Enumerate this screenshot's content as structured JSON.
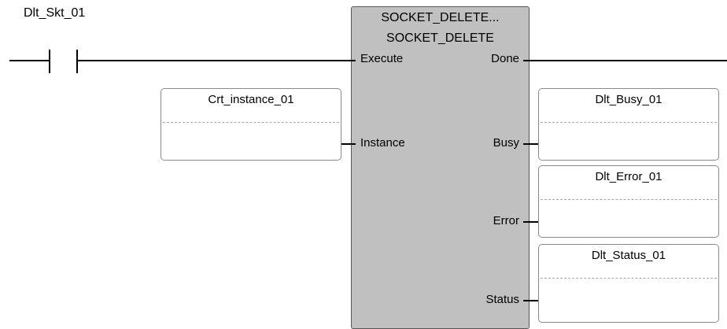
{
  "contact": {
    "variable": "Dlt_Skt_01"
  },
  "function_block": {
    "instance_name": "SOCKET_DELETE...",
    "type_name": "SOCKET_DELETE",
    "inputs": {
      "execute": "Execute",
      "instance": "Instance"
    },
    "outputs": {
      "done": "Done",
      "busy": "Busy",
      "error": "Error",
      "status": "Status"
    }
  },
  "variables": {
    "instance_input": "Crt_instance_01",
    "busy_output": "Dlt_Busy_01",
    "error_output": "Dlt_Error_01",
    "status_output": "Dlt_Status_01"
  }
}
